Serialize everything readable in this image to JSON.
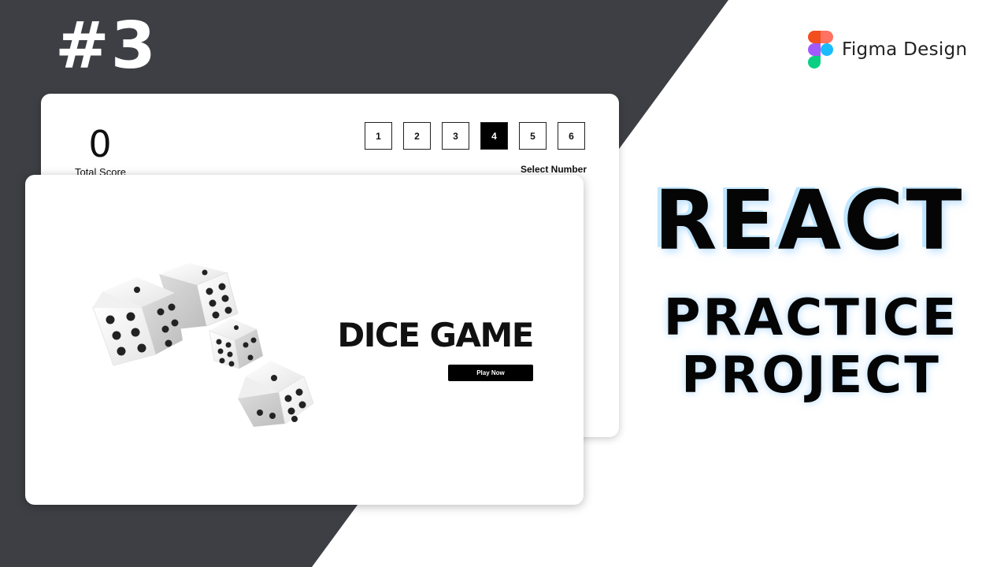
{
  "episode_label": "#3",
  "brand": {
    "name": "Figma Design",
    "icon": "figma-logo-icon"
  },
  "score_panel": {
    "total_score_value": "0",
    "total_score_label": "Total Score",
    "numbers": [
      "1",
      "2",
      "3",
      "4",
      "5",
      "6"
    ],
    "selected_number": "4",
    "select_label": "Select Number"
  },
  "start_screen": {
    "title": "DICE GAME",
    "play_button_label": "Play Now",
    "image_icon": "dice-illustration"
  },
  "headline": {
    "line1": "REACT",
    "line2": "PRACTICE",
    "line3": "PROJECT"
  },
  "colors": {
    "dark_bg": "#3d3f44",
    "light_bg": "#ffffff",
    "accent_black": "#000000",
    "glow": "#bfe6ff",
    "figma_red": "#f24e1e",
    "figma_orange": "#ff7262",
    "figma_purple": "#a259ff",
    "figma_blue": "#1abcfe",
    "figma_green": "#0acf83"
  }
}
